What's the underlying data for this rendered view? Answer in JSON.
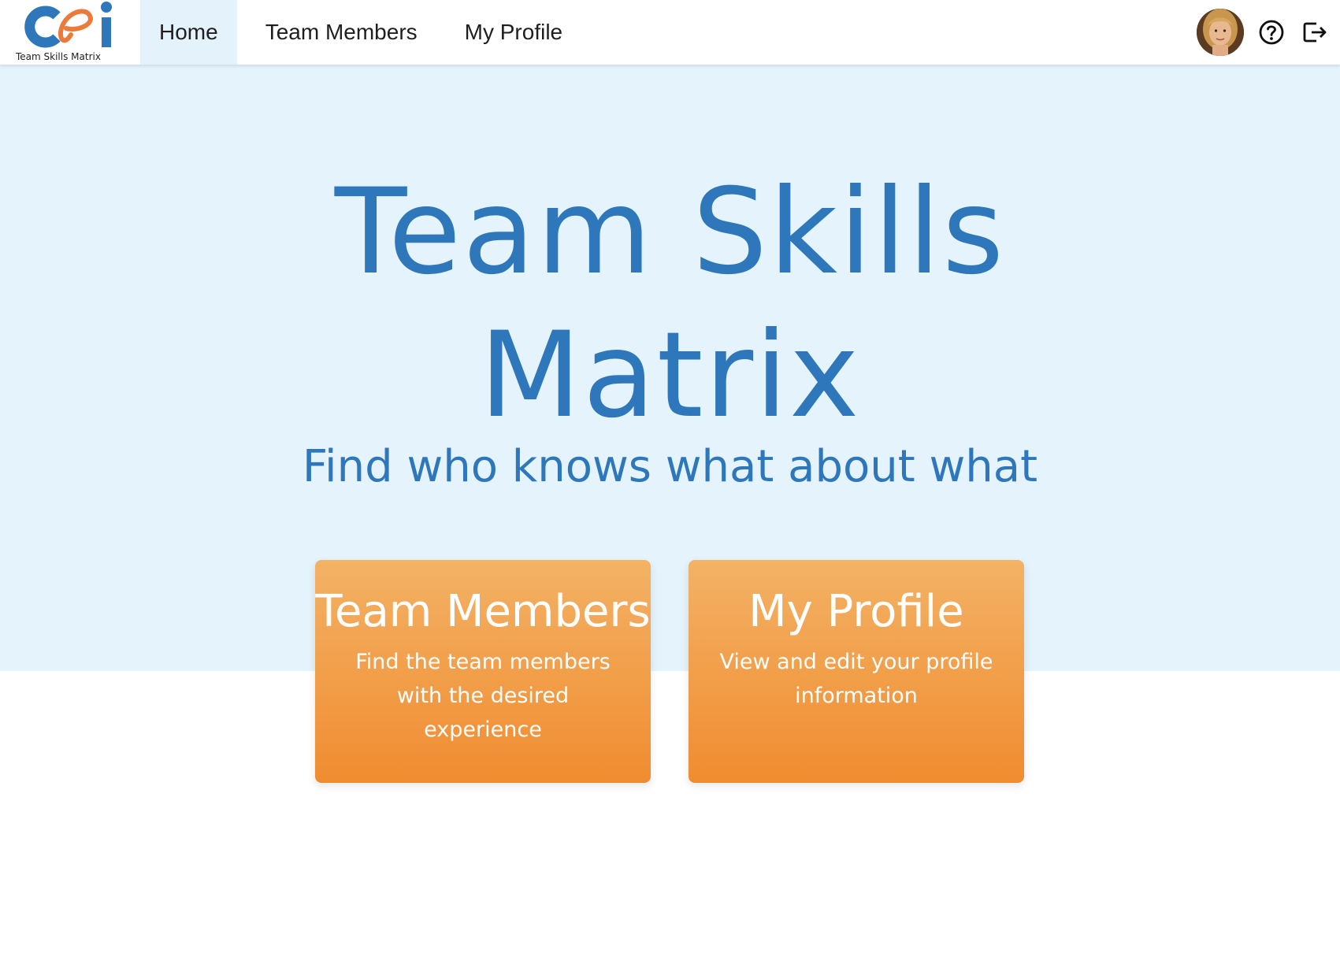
{
  "app": {
    "logo_caption": "Team Skills Matrix"
  },
  "nav": {
    "items": [
      {
        "label": "Home",
        "active": true
      },
      {
        "label": "Team Members",
        "active": false
      },
      {
        "label": "My Profile",
        "active": false
      }
    ]
  },
  "header_actions": {
    "avatar": "user-avatar",
    "help_icon": "help-circle-icon",
    "logout_icon": "logout-icon"
  },
  "hero": {
    "title_line1": "Team Skills",
    "title_line2": "Matrix",
    "subtitle": "Find who knows what about what"
  },
  "cards": [
    {
      "title": "Team Members",
      "description": "Find the team members with the desired experience"
    },
    {
      "title": "My Profile",
      "description": "View and edit your profile information"
    }
  ],
  "colors": {
    "accent_blue": "#2e77bb",
    "hero_background": "#e4f3fc",
    "card_orange_top": "#f3b265",
    "card_orange_bottom": "#f08c30",
    "logo_orange": "#ec7a3a"
  }
}
